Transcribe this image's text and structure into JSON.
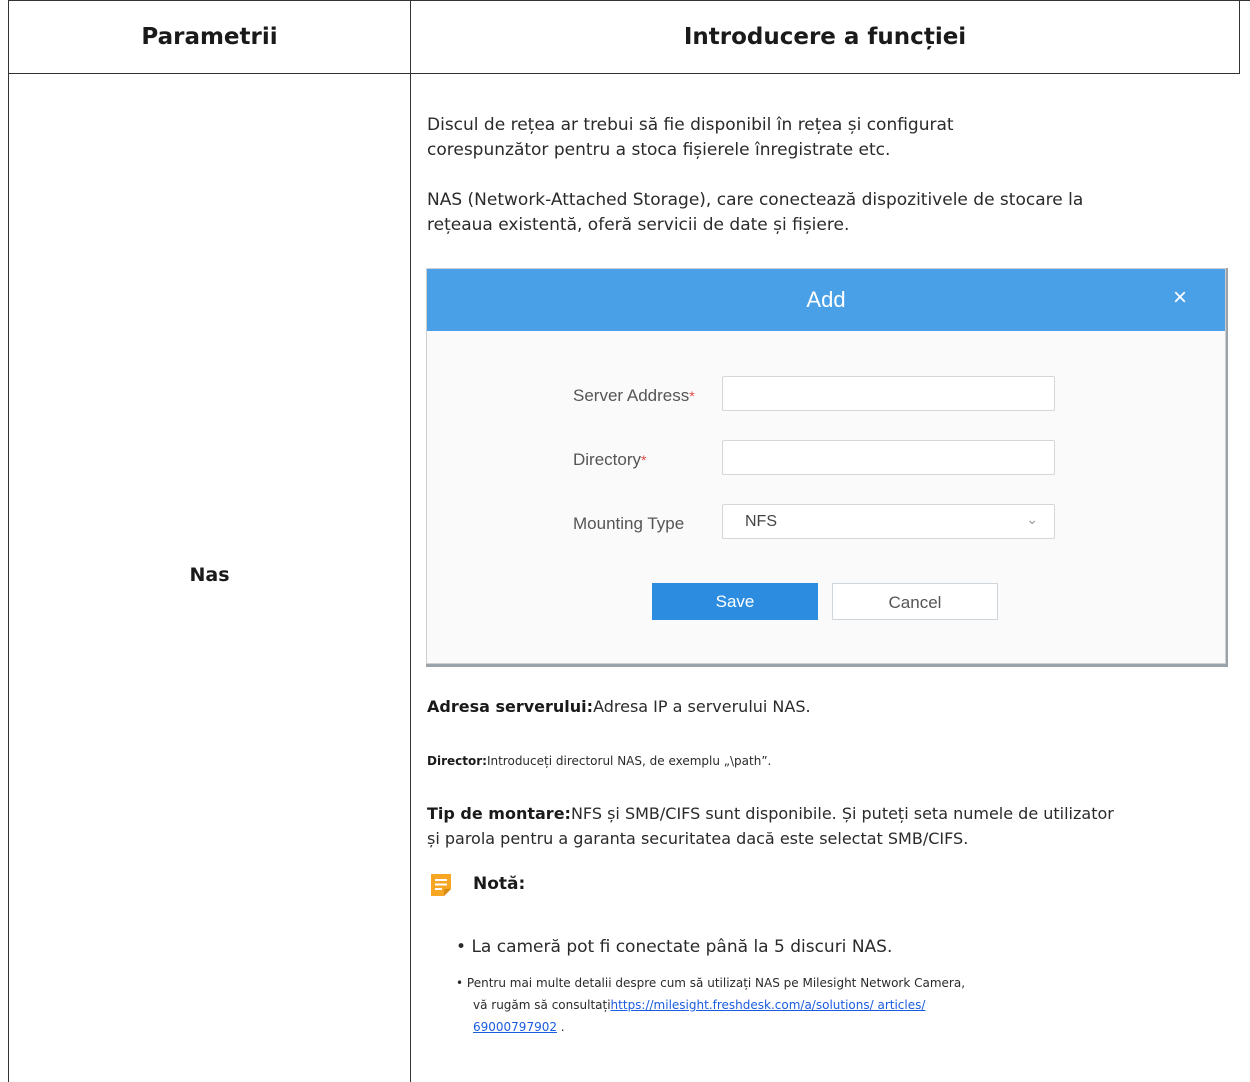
{
  "table": {
    "header": {
      "col1": "Parametrii",
      "col2": "Introducere a funcției"
    },
    "row": {
      "parameter": "Nas",
      "intro_para1_line1": "Discul de rețea ar trebui să fie disponibil în rețea și configurat",
      "intro_para1_line2": "corespunzător pentru a stoca fișierele înregistrate etc.",
      "intro_para2_line1": "NAS (Network-Attached Storage), care conectează dispozitivele de stocare la",
      "intro_para2_line2": "rețeaua existentă, oferă servicii de date și fișiere."
    }
  },
  "dialog": {
    "title": "Add",
    "close_glyph": "×",
    "server_address_label": "Server Address",
    "directory_label": "Directory",
    "required_mark": "*",
    "mounting_type_label": "Mounting Type",
    "mounting_type_value": "NFS",
    "save_label": "Save",
    "cancel_label": "Cancel",
    "accent_color": "#4aa0e6",
    "button_color": "#2c8de0"
  },
  "descriptions": {
    "server_label": "Adresa serverului:",
    "server_text": "Adresa IP a serverului NAS.",
    "director_label": "Director:",
    "director_text": "Introduceți directorul NAS, de exemplu „\\path”.",
    "type_label": "Tip de montare:",
    "type_text_line1": "NFS și SMB/CIFS sunt disponibile. Și puteți seta numele de utilizator",
    "type_text_line2": "și parola pentru a garanta securitatea dacă este selectat SMB/CIFS."
  },
  "note": {
    "label": "Notă:",
    "icon": "note-icon",
    "bullet1": "La cameră pot fi conectate până la 5 discuri NAS.",
    "bullet2_line1": "Pentru mai multe detalii despre cum să utilizați NAS pe Milesight Network Camera,",
    "bullet2_line2_prefix": "vă rugăm să consultați",
    "link_part1": "https://milesight.freshdesk.com/a/solutions/ articles/",
    "link_part2": "69000797902",
    "bullet2_suffix": " ."
  }
}
